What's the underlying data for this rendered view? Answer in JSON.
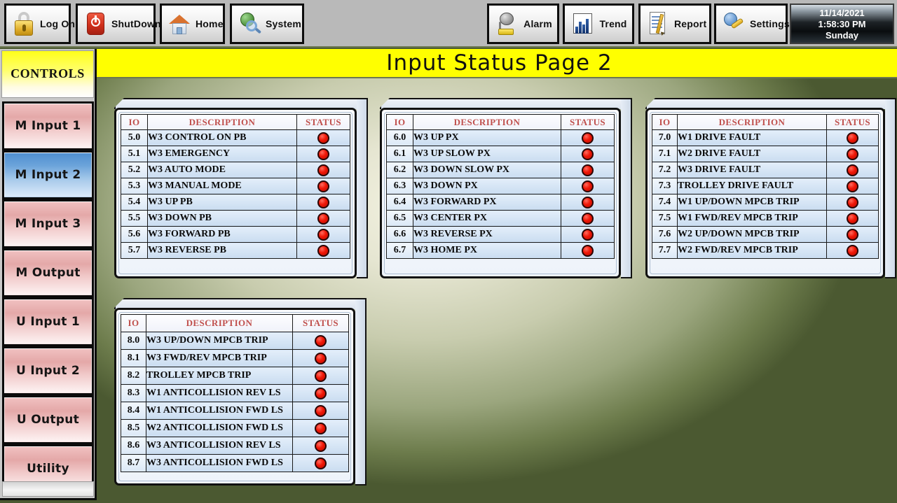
{
  "toolbar": {
    "buttons": [
      {
        "label": "Log On",
        "icon": "lock-icon"
      },
      {
        "label": "ShutDown",
        "icon": "power-icon"
      },
      {
        "label": "Home",
        "icon": "home-icon"
      },
      {
        "label": "System",
        "icon": "system-globe-icon"
      },
      {
        "label": "Alarm",
        "icon": "alarm-bell-icon"
      },
      {
        "label": "Trend",
        "icon": "trend-chart-icon"
      },
      {
        "label": "Report",
        "icon": "report-document-icon"
      },
      {
        "label": "Settings",
        "icon": "settings-gear-icon"
      }
    ],
    "datetime": {
      "date": "11/14/2021",
      "time": "1:58:30 PM",
      "day": "Sunday"
    }
  },
  "header": {
    "title": "Input  Status  Page  2",
    "title_background": "#ffff00"
  },
  "sidebar": {
    "heading": "CONTROLS",
    "items": [
      {
        "label": "M Input 1",
        "state": "inactive"
      },
      {
        "label": "M Input 2",
        "state": "active"
      },
      {
        "label": "M Input 3",
        "state": "inactive"
      },
      {
        "label": "M Output",
        "state": "inactive"
      },
      {
        "label": "U Input 1",
        "state": "inactive"
      },
      {
        "label": "U Input 2",
        "state": "inactive"
      },
      {
        "label": "U Output",
        "state": "inactive"
      },
      {
        "label": "Utility",
        "state": "inactive"
      }
    ],
    "active_color": "#6ba3da",
    "inactive_color": "#e4a8a8"
  },
  "columns": {
    "io": "IO",
    "description": "DESCRIPTION",
    "status": "STATUS"
  },
  "status_color_off": "#f01707",
  "panels": [
    {
      "id": "panel-5",
      "rows": [
        {
          "io": "5.0",
          "desc": "W3 CONTROL ON PB",
          "status": "off"
        },
        {
          "io": "5.1",
          "desc": "W3 EMERGENCY",
          "status": "off"
        },
        {
          "io": "5.2",
          "desc": "W3 AUTO MODE",
          "status": "off"
        },
        {
          "io": "5.3",
          "desc": "W3 MANUAL MODE",
          "status": "off"
        },
        {
          "io": "5.4",
          "desc": "W3 UP PB",
          "status": "off"
        },
        {
          "io": "5.5",
          "desc": "W3 DOWN PB",
          "status": "off"
        },
        {
          "io": "5.6",
          "desc": "W3 FORWARD PB",
          "status": "off"
        },
        {
          "io": "5.7",
          "desc": "W3 REVERSE PB",
          "status": "off"
        }
      ]
    },
    {
      "id": "panel-6",
      "rows": [
        {
          "io": "6.0",
          "desc": "W3 UP PX",
          "status": "off"
        },
        {
          "io": "6.1",
          "desc": "W3 UP SLOW PX",
          "status": "off"
        },
        {
          "io": "6.2",
          "desc": "W3 DOWN SLOW PX",
          "status": "off"
        },
        {
          "io": "6.3",
          "desc": "W3 DOWN PX",
          "status": "off"
        },
        {
          "io": "6.4",
          "desc": "W3 FORWARD PX",
          "status": "off"
        },
        {
          "io": "6.5",
          "desc": "W3 CENTER PX",
          "status": "off"
        },
        {
          "io": "6.6",
          "desc": "W3 REVERSE PX",
          "status": "off"
        },
        {
          "io": "6.7",
          "desc": "W3 HOME PX",
          "status": "off"
        }
      ]
    },
    {
      "id": "panel-7",
      "rows": [
        {
          "io": "7.0",
          "desc": "W1 DRIVE FAULT",
          "status": "off"
        },
        {
          "io": "7.1",
          "desc": "W2 DRIVE FAULT",
          "status": "off"
        },
        {
          "io": "7.2",
          "desc": "W3 DRIVE FAULT",
          "status": "off"
        },
        {
          "io": "7.3",
          "desc": "TROLLEY DRIVE FAULT",
          "status": "off"
        },
        {
          "io": "7.4",
          "desc": "W1 UP/DOWN MPCB TRIP",
          "status": "off"
        },
        {
          "io": "7.5",
          "desc": "W1 FWD/REV MPCB TRIP",
          "status": "off"
        },
        {
          "io": "7.6",
          "desc": "W2 UP/DOWN MPCB TRIP",
          "status": "off"
        },
        {
          "io": "7.7",
          "desc": "W2 FWD/REV MPCB TRIP",
          "status": "off"
        }
      ]
    },
    {
      "id": "panel-8",
      "rows": [
        {
          "io": "8.0",
          "desc": "W3 UP/DOWN MPCB TRIP",
          "status": "off"
        },
        {
          "io": "8.1",
          "desc": "W3 FWD/REV MPCB TRIP",
          "status": "off"
        },
        {
          "io": "8.2",
          "desc": "TROLLEY MPCB TRIP",
          "status": "off"
        },
        {
          "io": "8.3",
          "desc": "W1 ANTICOLLISION REV LS",
          "status": "off"
        },
        {
          "io": "8.4",
          "desc": "W1 ANTICOLLISION FWD LS",
          "status": "off"
        },
        {
          "io": "8.5",
          "desc": "W2 ANTICOLLISION FWD LS",
          "status": "off"
        },
        {
          "io": "8.6",
          "desc": "W3 ANTICOLLISION REV LS",
          "status": "off"
        },
        {
          "io": "8.7",
          "desc": "W3 ANTICOLLISION FWD LS",
          "status": "off"
        }
      ]
    }
  ]
}
